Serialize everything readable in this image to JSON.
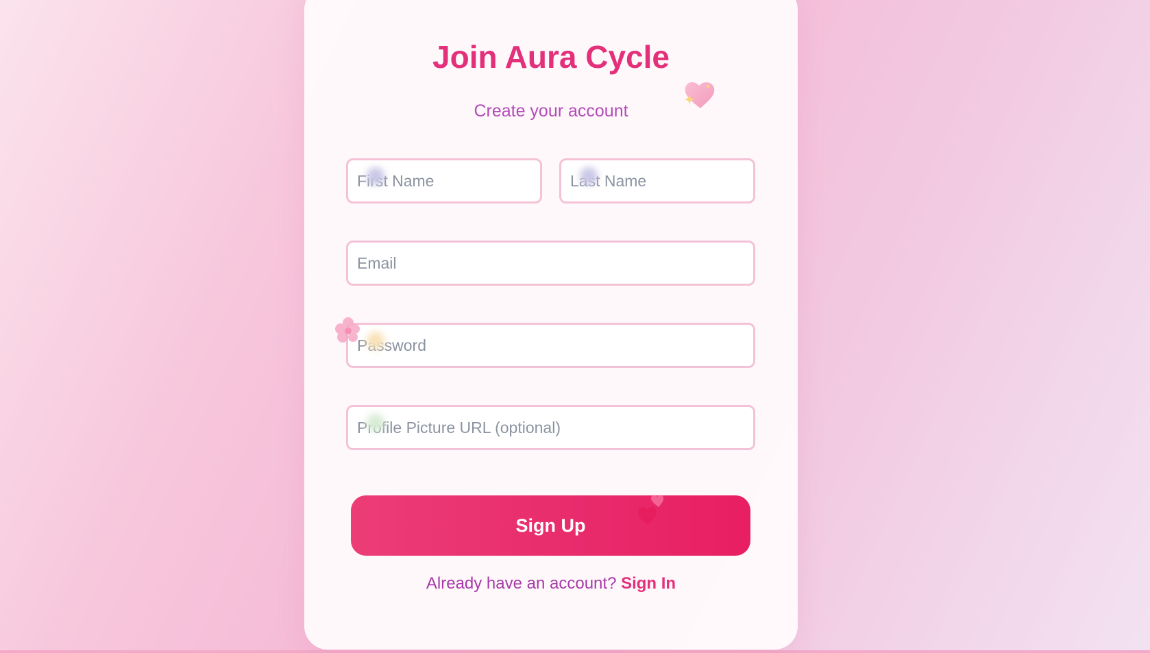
{
  "signup": {
    "title": "Join Aura Cycle",
    "subtitle": "Create your account",
    "fields": {
      "first_name": {
        "placeholder": "First Name",
        "value": ""
      },
      "last_name": {
        "placeholder": "Last Name",
        "value": ""
      },
      "email": {
        "placeholder": "Email",
        "value": ""
      },
      "password": {
        "placeholder": "Password",
        "value": ""
      },
      "profile_picture": {
        "placeholder": "Profile Picture URL (optional)",
        "value": ""
      }
    },
    "submit_label": "Sign Up",
    "footer_prompt": "Already have an account? ",
    "signin_label": "Sign In"
  },
  "theme": {
    "accent": "#e3307a",
    "subtitle_color": "#b24cb8",
    "input_border": "#f4c2d6",
    "button_gradient_start": "#ec3d77",
    "button_gradient_end": "#e81f62"
  },
  "decorations": [
    "heart-sparkle-icon",
    "flower-icon",
    "double-heart-icon"
  ]
}
